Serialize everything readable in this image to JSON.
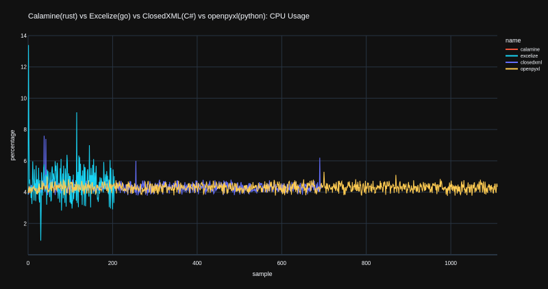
{
  "chart_data": {
    "type": "line",
    "title": "Calamine(rust) vs Excelize(go) vs ClosedXML(C#) vs openpyxl(python): CPU Usage",
    "xlabel": "sample",
    "ylabel": "percentage",
    "xlim": [
      0,
      1110
    ],
    "ylim": [
      0,
      14
    ],
    "xticks": [
      0,
      200,
      400,
      600,
      800,
      1000
    ],
    "yticks": [
      2,
      4,
      6,
      8,
      10,
      12,
      14
    ],
    "grid": true,
    "legend": {
      "title": "name",
      "position": "top-right"
    },
    "series": [
      {
        "name": "calamine",
        "color": "#ef553b",
        "n": 5,
        "base": 4.2,
        "amp": 0.2,
        "seed": 11,
        "spikes": []
      },
      {
        "name": "excelize",
        "color": "#19d3f3",
        "n": 205,
        "base": 4.6,
        "amp": 1.2,
        "seed": 23,
        "spikes": [
          [
            1,
            13.4
          ],
          [
            2,
            7.6
          ],
          [
            30,
            0.9
          ],
          [
            60,
            5.2
          ],
          [
            115,
            9.1
          ],
          [
            145,
            7.0
          ],
          [
            200,
            2.9
          ]
        ]
      },
      {
        "name": "closedxml",
        "color": "#636efa",
        "n": 695,
        "base": 4.3,
        "amp": 0.35,
        "seed": 37,
        "spikes": [
          [
            38,
            7.6
          ],
          [
            42,
            7.4
          ],
          [
            255,
            6.0
          ],
          [
            690,
            6.2
          ]
        ]
      },
      {
        "name": "openpyxl",
        "color": "#fecb52",
        "n": 1111,
        "base": 4.3,
        "amp": 0.35,
        "seed": 53,
        "spikes": [
          [
            45,
            5.0
          ],
          [
            700,
            5.3
          ],
          [
            870,
            5.1
          ]
        ]
      }
    ]
  }
}
